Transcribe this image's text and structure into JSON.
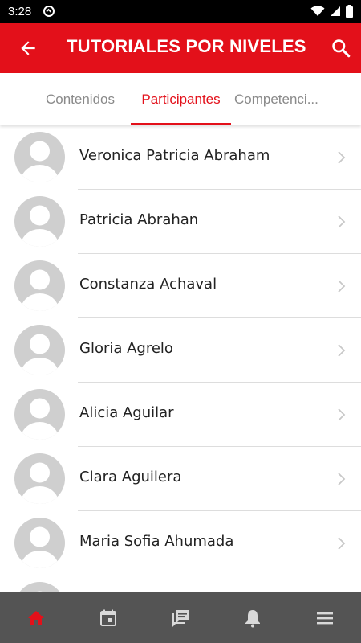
{
  "status_bar": {
    "time": "3:28"
  },
  "app_bar": {
    "title": "TUTORIALES POR NIVELES"
  },
  "tabs": [
    {
      "label": "Contenidos",
      "selected": false
    },
    {
      "label": "Participantes",
      "selected": true
    },
    {
      "label": "Competenci...",
      "selected": false
    }
  ],
  "participants": [
    {
      "name": "Veronica Patricia Abraham"
    },
    {
      "name": "Patricia Abrahan"
    },
    {
      "name": "Constanza Achaval"
    },
    {
      "name": "Gloria Agrelo"
    },
    {
      "name": "Alicia Aguilar"
    },
    {
      "name": "Clara Aguilera"
    },
    {
      "name": "Maria Sofia Ahumada"
    },
    {
      "name": ""
    }
  ],
  "bottom_nav": [
    {
      "icon": "home-icon",
      "active": true
    },
    {
      "icon": "calendar-icon",
      "active": false
    },
    {
      "icon": "messages-icon",
      "active": false
    },
    {
      "icon": "bell-icon",
      "active": false
    },
    {
      "icon": "menu-icon",
      "active": false
    }
  ],
  "colors": {
    "accent": "#e3101a",
    "bottom_nav_bg": "#545454",
    "nav_icon": "#d9d9d9",
    "avatar_bg": "#cfcfcf"
  }
}
